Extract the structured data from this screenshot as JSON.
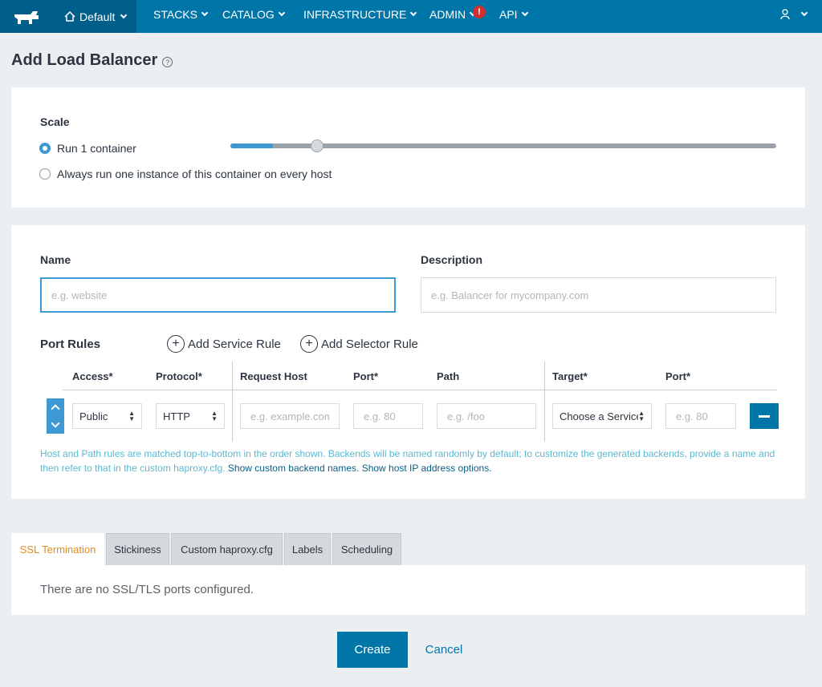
{
  "nav": {
    "environment": "Default",
    "items": [
      {
        "label": "STACKS"
      },
      {
        "label": "CATALOG"
      },
      {
        "label": "INFRASTRUCTURE"
      },
      {
        "label": "ADMIN"
      },
      {
        "label": "API"
      }
    ],
    "admin_alert": "!",
    "icons": {
      "logo": "rancher-cow-logo",
      "home": "home-icon",
      "user": "user-icon"
    }
  },
  "page": {
    "title": "Add Load Balancer",
    "help": "?"
  },
  "scale": {
    "label": "Scale",
    "option_run": "Run 1 container",
    "option_every_host": "Always run one instance of this container on every host",
    "selected": "run",
    "slider_value": 1,
    "slider_fraction": 0.078
  },
  "form": {
    "name_label": "Name",
    "name_placeholder": "e.g. website",
    "description_label": "Description",
    "description_placeholder": "e.g. Balancer for mycompany.com"
  },
  "port_rules": {
    "label": "Port Rules",
    "add_service_rule": "Add Service Rule",
    "add_selector_rule": "Add Selector Rule",
    "headers": {
      "access": "Access*",
      "protocol": "Protocol*",
      "request_host": "Request Host",
      "port": "Port*",
      "path": "Path",
      "target": "Target*",
      "target_port": "Port*"
    },
    "row": {
      "access": "Public",
      "protocol": "HTTP",
      "host_placeholder": "e.g. example.com",
      "port_placeholder": "e.g. 80",
      "path_placeholder": "e.g. /foo",
      "target": "Choose a Service",
      "target_port_placeholder": "e.g. 80"
    },
    "help_text": "Host and Path rules are matched top-to-bottom in the order shown. Backends will be named randomly by default; to customize the generated backends, provide a name and then refer to that in the custom haproxy.cfg.",
    "link_backend_names": "Show custom backend names.",
    "link_host_ip": "Show host IP address options."
  },
  "tabs": [
    {
      "label": "SSL Termination"
    },
    {
      "label": "Stickiness"
    },
    {
      "label": "Custom haproxy.cfg"
    },
    {
      "label": "Labels"
    },
    {
      "label": "Scheduling"
    }
  ],
  "ssl": {
    "empty_text": "There are no SSL/TLS ports configured."
  },
  "actions": {
    "create": "Create",
    "cancel": "Cancel"
  },
  "colors": {
    "nav": "#0075a8",
    "nav_dark": "#005f8a",
    "accent": "#3d98d3",
    "active_tab": "#e48b1e"
  }
}
